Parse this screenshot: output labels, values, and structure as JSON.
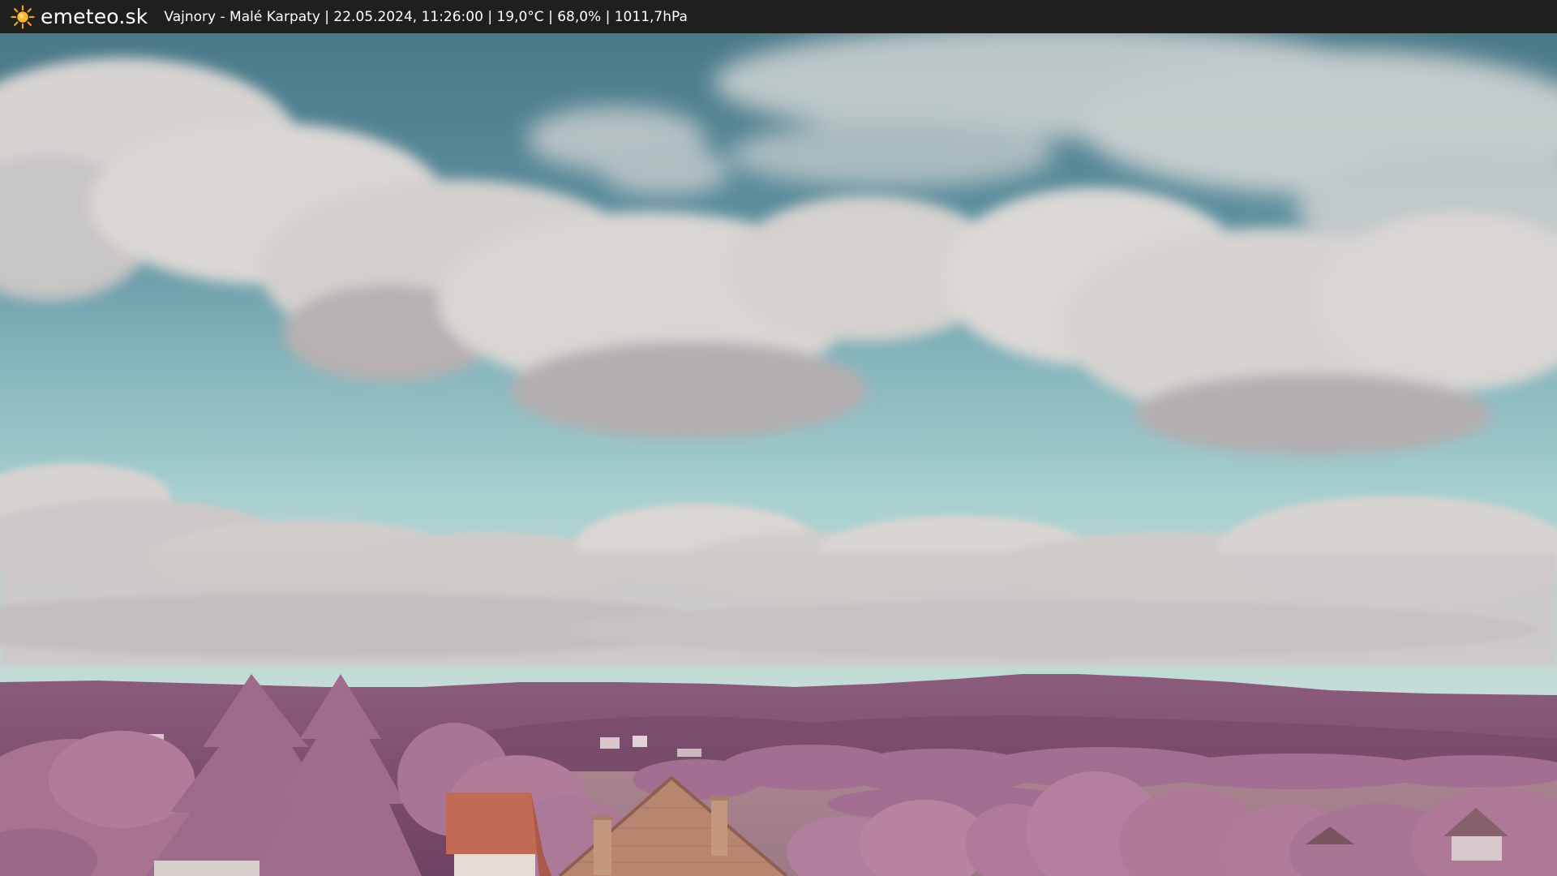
{
  "header": {
    "brand": "emeteo.sk",
    "logo_icon": "sun-icon",
    "caption": "Vajnory - Malé Karpaty | 22.05.2024, 11:26:00 | 19,0°C | 68,0% | 1011,7hPa"
  },
  "colors": {
    "bar_background": "#1f1f1f",
    "sun": "#f2a11c",
    "sky_top": "#4d7d8e",
    "sky_bottom": "#a9d2d0",
    "cloud": "#d7d5d2",
    "hills": "#7b4f6c",
    "foliage": "#b07a9f",
    "roof": "#c86a52"
  }
}
